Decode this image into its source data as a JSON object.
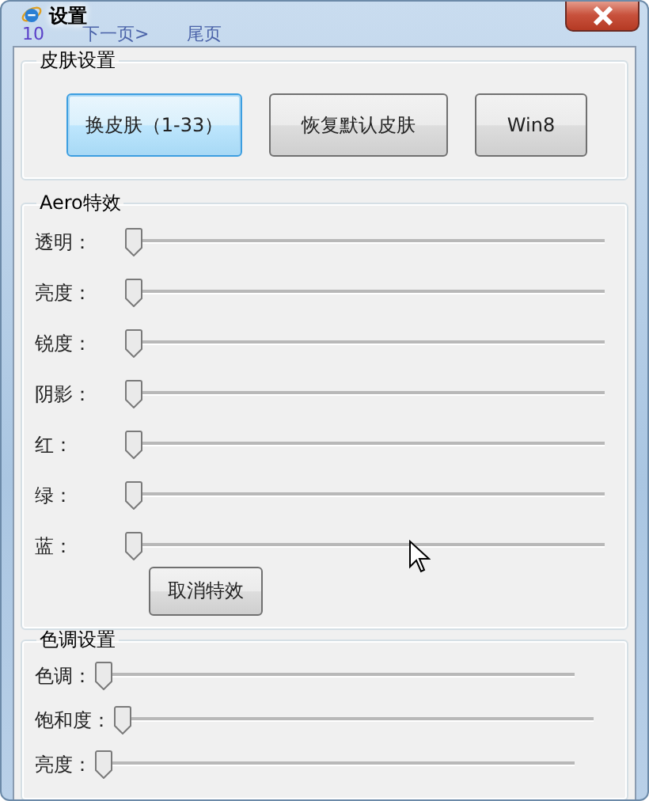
{
  "window": {
    "title": "设置"
  },
  "background_page": [
    "10",
    "下一页>",
    "尾页"
  ],
  "skin_group": {
    "title": "皮肤设置",
    "buttons": [
      {
        "label": "换皮肤（1-33）",
        "focused": true
      },
      {
        "label": "恢复默认皮肤",
        "focused": false
      },
      {
        "label": "Win8",
        "focused": false
      }
    ]
  },
  "aero_group": {
    "title": "Aero特效",
    "sliders": [
      {
        "label": "透明：",
        "level": 0
      },
      {
        "label": "亮度：",
        "level": 0
      },
      {
        "label": "锐度：",
        "level": 0
      },
      {
        "label": "阴影：",
        "level": 0
      },
      {
        "label": "红：",
        "level": 0
      },
      {
        "label": "绿：",
        "level": 0
      },
      {
        "label": "蓝：",
        "level": 0
      }
    ],
    "button": "取消特效"
  },
  "tone_group": {
    "title": "色调设置",
    "sliders": [
      {
        "label": "色调：",
        "level": 0
      },
      {
        "label": "饱和度：",
        "level": 0
      },
      {
        "label": "亮度：",
        "level": 0
      }
    ]
  }
}
